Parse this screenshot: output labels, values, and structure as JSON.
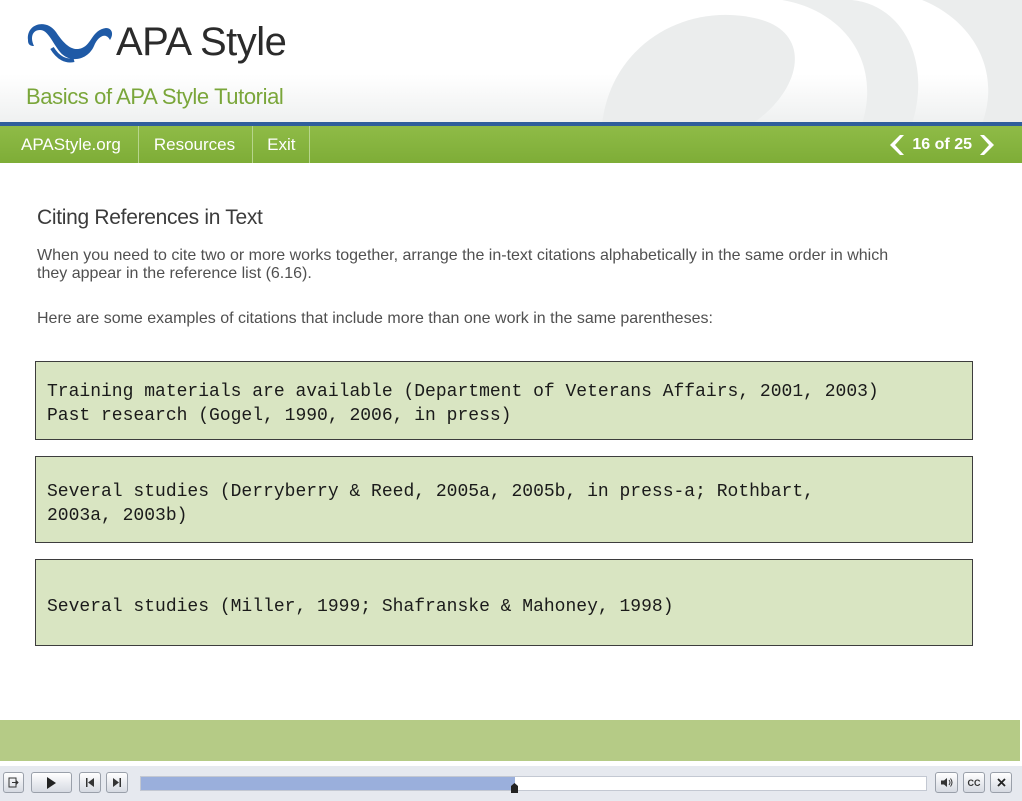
{
  "header": {
    "logo_text": "APA Style",
    "subtitle": "Basics of APA Style Tutorial"
  },
  "nav": {
    "items": [
      {
        "label": "APAStyle.org"
      },
      {
        "label": "Resources"
      },
      {
        "label": "Exit"
      }
    ],
    "pager": {
      "label": "16 of 25",
      "current": 16,
      "total": 25
    }
  },
  "content": {
    "title": "Citing References in Text",
    "paragraph1": "When you need to cite two or more works together, arrange the in-text citations alphabetically in the same order in which they appear in the reference list (6.16).",
    "paragraph2": "Here are some examples of citations that include more than one work in the same parentheses:",
    "examples": [
      {
        "lines": [
          "Training materials are available (Department of Veterans Affairs, 2001, 2003)",
          "Past research (Gogel, 1990, 2006, in press)"
        ]
      },
      {
        "lines": [
          "Several studies (Derryberry & Reed, 2005a, 2005b, in press-a; Rothbart,",
          "2003a, 2003b)"
        ]
      },
      {
        "lines": [
          "Several studies (Miller, 1999; Shafranske & Mahoney, 1998)"
        ]
      }
    ]
  },
  "player": {
    "progress": 0.476,
    "cc_label": "CC",
    "icons": [
      "exit-icon",
      "play-icon",
      "prev-icon",
      "next-icon",
      "volume-icon",
      "cc-icon",
      "close-icon"
    ]
  },
  "colors": {
    "nav_green": "#84b13d",
    "subtitle_green": "#7aa63a",
    "rule_blue": "#2f5e9c",
    "box_bg": "#d9e5c2",
    "band": "#b5cb86",
    "progress_fill": "#9aafdc"
  }
}
